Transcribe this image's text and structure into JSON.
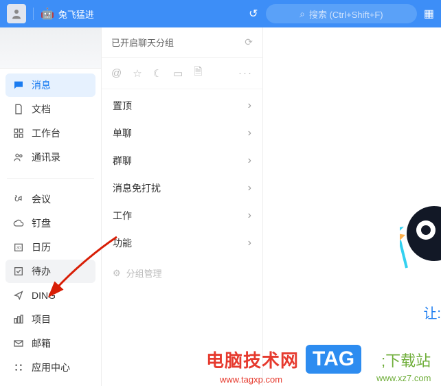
{
  "header": {
    "title": "兔飞猛进",
    "search_placeholder": "搜索 (Ctrl+Shift+F)"
  },
  "sidebar": {
    "items": [
      {
        "label": "消息",
        "icon": "message",
        "active": true,
        "highlight": false
      },
      {
        "label": "文档",
        "icon": "document",
        "active": false,
        "highlight": false
      },
      {
        "label": "工作台",
        "icon": "workspace",
        "active": false,
        "highlight": false
      },
      {
        "label": "通讯录",
        "icon": "contacts",
        "active": false,
        "highlight": false
      }
    ],
    "items2": [
      {
        "label": "会议",
        "icon": "meeting"
      },
      {
        "label": "钉盘",
        "icon": "cloud"
      },
      {
        "label": "日历",
        "icon": "calendar"
      },
      {
        "label": "待办",
        "icon": "todo",
        "highlight": true
      },
      {
        "label": "DING",
        "icon": "ding"
      },
      {
        "label": "项目",
        "icon": "project"
      },
      {
        "label": "邮箱",
        "icon": "mail"
      },
      {
        "label": "应用中心",
        "icon": "appcenter"
      }
    ]
  },
  "panel": {
    "header": "已开启聊天分组",
    "groups": [
      {
        "label": "置顶"
      },
      {
        "label": "单聊"
      },
      {
        "label": "群聊"
      },
      {
        "label": "消息免打扰"
      },
      {
        "label": "工作"
      },
      {
        "label": "功能"
      }
    ],
    "manage": "分组管理"
  },
  "main": {
    "tagline_partial": "让:"
  },
  "watermarks": {
    "red_text": "电脑技术网",
    "red_url": "www.tagxp.com",
    "tag_badge": "TAG",
    "green_text": ";下载站",
    "green_url": "www.xz7.com"
  }
}
